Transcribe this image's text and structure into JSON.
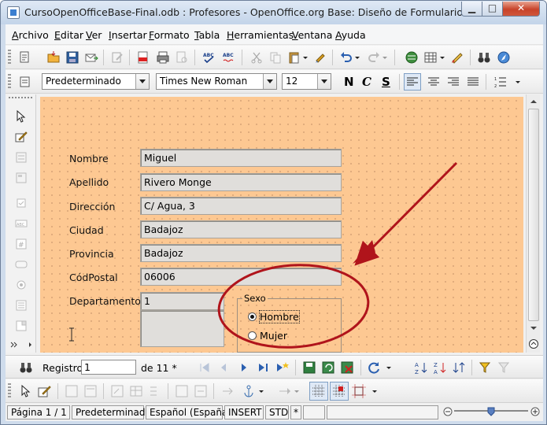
{
  "window": {
    "title": "CursoOpenOfficeBase-Final.odb : Profesores - OpenOffice.org Base: Diseño de Formularios",
    "controls": {
      "minimize": "▁",
      "maximize": "□",
      "close": "✕"
    }
  },
  "menu": [
    "Archivo",
    "Editar",
    "Ver",
    "Insertar",
    "Formato",
    "Tabla",
    "Herramientas",
    "Ventana",
    "Ayuda"
  ],
  "formatting": {
    "style": "Predeterminado",
    "font": "Times New Roman",
    "size": "12",
    "bold": "N",
    "italic": "C",
    "underline": "S"
  },
  "form": {
    "fields": [
      {
        "label": "Nombre",
        "value": "Miguel"
      },
      {
        "label": "Apellido",
        "value": "Rivero Monge"
      },
      {
        "label": "Dirección",
        "value": "C/ Agua, 3"
      },
      {
        "label": "Ciudad",
        "value": "Badajoz"
      },
      {
        "label": "Provincia",
        "value": "Badajoz"
      },
      {
        "label": "CódPostal",
        "value": "06006"
      }
    ],
    "departamento": {
      "label": "Departamento",
      "value": "1"
    },
    "sexo": {
      "legend": "Sexo",
      "options": [
        {
          "label": "Hombre",
          "selected": true
        },
        {
          "label": "Mujer",
          "selected": false
        }
      ]
    },
    "annotation_color": "#b0141b"
  },
  "record_bar": {
    "label": "Registro",
    "current": "1",
    "total": "de 11 *"
  },
  "status_bar": {
    "page": "Página 1 / 1",
    "style": "Predeterminado",
    "language": "Español (España)",
    "insert_mode": "INSERT",
    "selection_mode": "STD",
    "modified": "*"
  },
  "colors": {
    "form_background": "#fdc892",
    "field_background": "#e0dedb"
  }
}
